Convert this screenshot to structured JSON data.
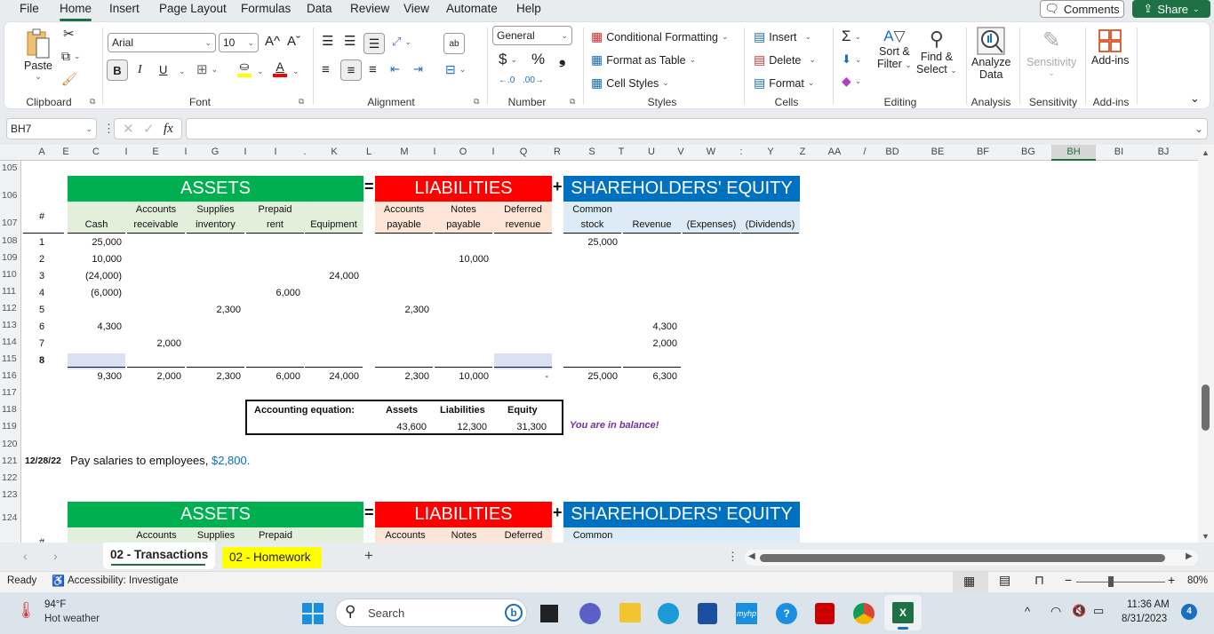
{
  "menu": {
    "items": [
      "File",
      "Home",
      "Insert",
      "Page Layout",
      "Formulas",
      "Data",
      "Review",
      "View",
      "Automate",
      "Help"
    ],
    "active": "Home",
    "comments_label": "Comments",
    "share_label": "Share"
  },
  "ribbon": {
    "clipboard": {
      "paste_label": "Paste",
      "group_label": "Clipboard"
    },
    "font": {
      "font_name": "Arial",
      "font_size": "10",
      "group_label": "Font",
      "bold": "B",
      "italic": "I",
      "underline": "U",
      "grow": "A^",
      "shrink": "Aˇ",
      "font_color_glyph": "A",
      "fill_color": "#ffff00",
      "font_color": "#ff0000"
    },
    "alignment": {
      "group_label": "Alignment"
    },
    "number": {
      "format": "General",
      "currency": "$",
      "percent": "%",
      "comma": "❟",
      "group_label": "Number"
    },
    "styles": {
      "conditional_formatting": "Conditional Formatting",
      "format_as_table": "Format as Table",
      "cell_styles": "Cell Styles",
      "group_label": "Styles"
    },
    "cells": {
      "insert": "Insert",
      "delete": "Delete",
      "format": "Format",
      "group_label": "Cells"
    },
    "editing": {
      "sort_filter_line1": "Sort &",
      "sort_filter_line2": "Filter",
      "find_select_line1": "Find &",
      "find_select_line2": "Select",
      "group_label": "Editing"
    },
    "analysis": {
      "analyze_line1": "Analyze",
      "analyze_line2": "Data",
      "group_label": "Analysis"
    },
    "sensitivity": {
      "label": "Sensitivity",
      "group_label": "Sensitivity"
    },
    "addins": {
      "label": "Add-ins",
      "group_label": "Add-ins"
    }
  },
  "formula_bar": {
    "name_box": "BH7",
    "fx": "fx",
    "formula": ""
  },
  "columns": [
    "A",
    "B",
    "C",
    "D",
    "E",
    "F",
    "G",
    "H",
    "I",
    "J",
    "K",
    "L",
    "M",
    "N",
    "O",
    "P",
    "Q",
    "R",
    "S",
    "T",
    "U",
    "V",
    "W",
    "X",
    "Y",
    "Z",
    "AA",
    "AB",
    "BD",
    "BE",
    "BF",
    "BG",
    "BH",
    "BI",
    "BJ"
  ],
  "column_labels_visible": [
    "A",
    "E",
    "C",
    "I",
    "E",
    "I",
    "G",
    "I",
    "I",
    ".",
    "K",
    "L",
    "M",
    "I",
    "O",
    "I",
    "Q",
    "R",
    "S",
    "T",
    "U",
    "V",
    "W",
    ":",
    "Y",
    "Z",
    "AA",
    "/",
    "BD",
    "BE",
    "BF",
    "BG",
    "BH",
    "BI",
    "BJ"
  ],
  "selected_column": "BH",
  "rows": [
    "105",
    "106",
    "107",
    "108",
    "109",
    "110",
    "111",
    "112",
    "113",
    "114",
    "115",
    "116",
    "117",
    "118",
    "119",
    "120",
    "121",
    "122",
    "123",
    "124"
  ],
  "table": {
    "assets_title": "ASSETS",
    "equals": "=",
    "liabilities_title": "LIABILITIES",
    "plus": "+",
    "equity_title": "SHAREHOLDERS' EQUITY",
    "hash": "#",
    "headers": [
      {
        "l1": "",
        "l2": "Cash"
      },
      {
        "l1": "Accounts",
        "l2": "receivable"
      },
      {
        "l1": "Supplies",
        "l2": "inventory"
      },
      {
        "l1": "Prepaid",
        "l2": "rent"
      },
      {
        "l1": "",
        "l2": "Equipment"
      },
      {
        "l1": "Accounts",
        "l2": "payable"
      },
      {
        "l1": "Notes",
        "l2": "payable"
      },
      {
        "l1": "Deferred",
        "l2": "revenue"
      },
      {
        "l1": "Common",
        "l2": "stock"
      },
      {
        "l1": "",
        "l2": "Revenue"
      },
      {
        "l1": "",
        "l2": "(Expenses)"
      },
      {
        "l1": "",
        "l2": "(Dividends)"
      }
    ],
    "transactions": [
      {
        "n": "1",
        "v": [
          "25,000",
          "",
          "",
          "",
          "",
          "",
          "",
          "",
          "25,000",
          "",
          "",
          ""
        ]
      },
      {
        "n": "2",
        "v": [
          "10,000",
          "",
          "",
          "",
          "",
          "",
          "10,000",
          "",
          "",
          "",
          "",
          ""
        ]
      },
      {
        "n": "3",
        "v": [
          "(24,000)",
          "",
          "",
          "",
          "24,000",
          "",
          "",
          "",
          "",
          "",
          "",
          ""
        ]
      },
      {
        "n": "4",
        "v": [
          "(6,000)",
          "",
          "",
          "6,000",
          "",
          "",
          "",
          "",
          "",
          "",
          "",
          ""
        ]
      },
      {
        "n": "5",
        "v": [
          "",
          "",
          "2,300",
          "",
          "",
          "2,300",
          "",
          "",
          "",
          "",
          "",
          ""
        ]
      },
      {
        "n": "6",
        "v": [
          "4,300",
          "",
          "",
          "",
          "",
          "",
          "",
          "",
          "",
          "4,300",
          "",
          ""
        ]
      },
      {
        "n": "7",
        "v": [
          "",
          "2,000",
          "",
          "",
          "",
          "",
          "",
          "",
          "",
          "2,000",
          "",
          ""
        ]
      },
      {
        "n": "8",
        "v": [
          "",
          "",
          "",
          "",
          "",
          "",
          "",
          "",
          "",
          "",
          "",
          ""
        ]
      }
    ],
    "totals": [
      "9,300",
      "2,000",
      "2,300",
      "6,000",
      "24,000",
      "2,300",
      "10,000",
      "-",
      "25,000",
      "6,300",
      "",
      ""
    ]
  },
  "equation": {
    "label": "Accounting equation:",
    "assets_label": "Assets",
    "liabilities_label": "Liabilities",
    "equity_label": "Equity",
    "assets": "43,600",
    "liabilities": "12,300",
    "equity": "31,300",
    "balance_msg": "You are in balance!"
  },
  "next_transaction": {
    "date": "12/28/22",
    "text": "Pay salaries to employees,",
    "amount": "$2,800."
  },
  "table2": {
    "assets_title": "ASSETS",
    "equals": "=",
    "liabilities_title": "LIABILITIES",
    "plus": "+",
    "equity_title": "SHAREHOLDERS' EQUITY",
    "hash": "#",
    "partial_headers": [
      "Accounts",
      "Supplies",
      "Prepaid",
      "Accounts",
      "Notes",
      "Deferred",
      "Common"
    ]
  },
  "sheet_tabs": [
    {
      "label": "02 - Transactions",
      "active": true
    },
    {
      "label": "02 - Homework",
      "color": "#ffff00"
    }
  ],
  "status": {
    "ready": "Ready",
    "accessibility": "Accessibility: Investigate",
    "zoom": "80%",
    "zoom_value_percent": 80
  },
  "taskbar": {
    "temp": "94°F",
    "weather": "Hot weather",
    "search_placeholder": "Search",
    "time": "11:36 AM",
    "date": "8/31/2023",
    "notification_count": "4"
  },
  "colors": {
    "assets": "#00b050",
    "liabilities": "#ff0000",
    "equity": "#0070c0",
    "assets_sub": "#e2efda",
    "liab_sub": "#fce4d6",
    "equity_sub": "#ddebf7",
    "input_cell": "#d9e1f2",
    "balance_msg": "#7030a0",
    "amount_link": "#0070c0",
    "excel_green": "#1e7145"
  }
}
